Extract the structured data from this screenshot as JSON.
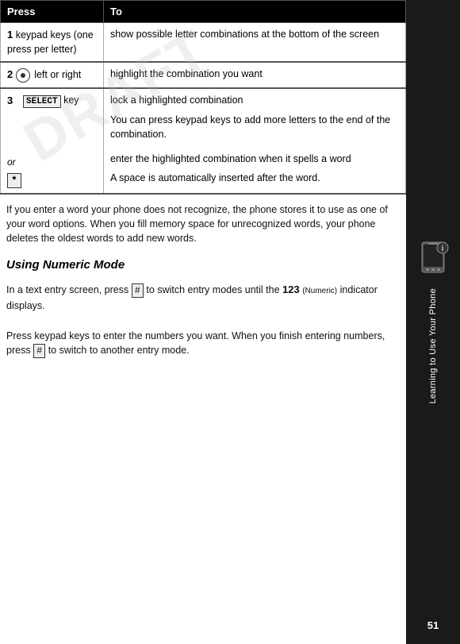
{
  "header": {
    "press_col": "Press",
    "to_col": "To"
  },
  "table": {
    "rows": [
      {
        "num": "1",
        "press": "keypad keys (one press per letter)",
        "to": "show possible letter combinations at the bottom of the screen"
      },
      {
        "num": "2",
        "press_icon": "nav-icon",
        "press_text": "left or right",
        "to": "highlight the combination you want"
      },
      {
        "num": "3",
        "press_select": "SELECT",
        "press_text_select": " key",
        "to_select": "lock a highlighted combination",
        "to_note": "You can press keypad keys to add more letters to the end of the combination.",
        "or_label": "or",
        "press_star": "*",
        "to_star": "enter the highlighted combination when it spells a word",
        "to_star_note": "A space is automatically inserted after the word."
      }
    ]
  },
  "body1": "If you enter a word your phone does not recognize, the phone stores it to use as one of your word options. When you fill memory space for unrecognized words, your phone deletes the oldest words to add new words.",
  "section_title": "Using Numeric Mode",
  "body2_part1": "In a text entry screen, press",
  "body2_hash": "#",
  "body2_part2": "to switch entry modes until the",
  "body2_numeric": "123",
  "body2_numeric_label": "(Numeric)",
  "body2_part3": "indicator displays.",
  "body3_part1": "Press keypad keys to enter the numbers you want. When you finish entering numbers, press",
  "body3_hash": "#",
  "body3_part2": "to switch to another entry mode.",
  "sidebar": {
    "text": "Learning to Use Your Phone"
  },
  "page_number": "51",
  "watermark": "DRAFT"
}
